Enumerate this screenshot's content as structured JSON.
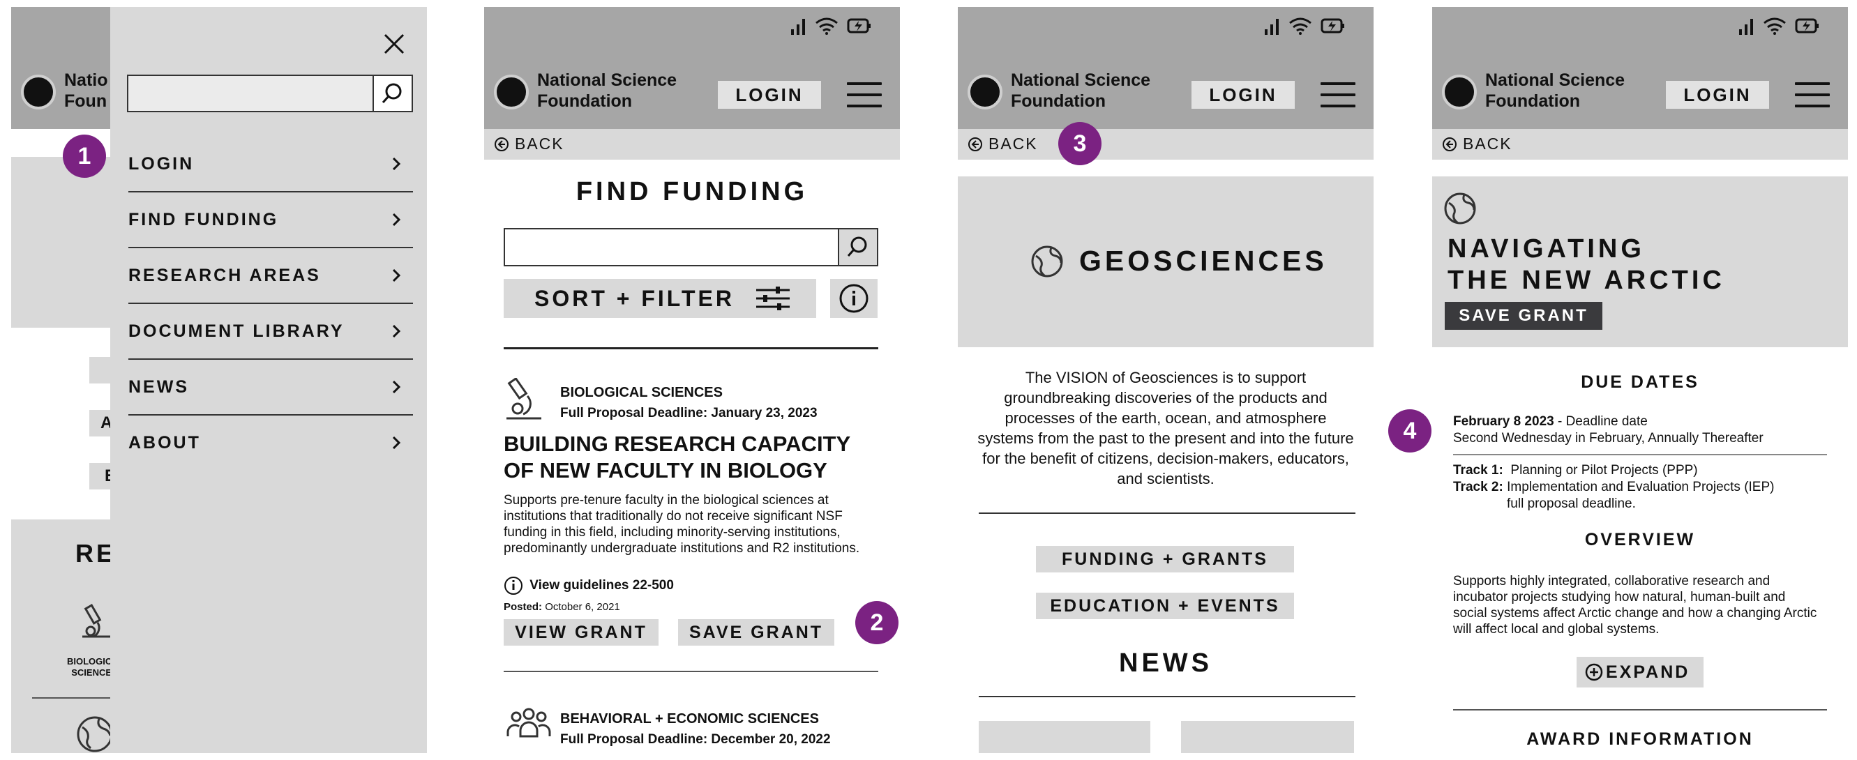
{
  "brand": {
    "line1": "National Science",
    "line2": "Foundation"
  },
  "brand_cutoff": {
    "line1": "Natio",
    "line2": "Foun"
  },
  "login_label": "LOGIN",
  "back_label": "BACK",
  "badges": [
    "1",
    "2",
    "3",
    "4"
  ],
  "menu": {
    "items": [
      {
        "label": "LOGIN"
      },
      {
        "label": "FIND FUNDING"
      },
      {
        "label": "RESEARCH AREAS"
      },
      {
        "label": "DOCUMENT LIBRARY"
      },
      {
        "label": "NEWS"
      },
      {
        "label": "ABOUT"
      }
    ],
    "search_placeholder": ""
  },
  "bg_screen": {
    "letter_a": "A",
    "letter_e": "E",
    "section_title": "RE",
    "bio_label_line1": "BIOLOGIC",
    "bio_label_line2": "SCIENCE"
  },
  "find_funding": {
    "title": "FIND FUNDING",
    "search_placeholder": "",
    "sort_filter_label": "SORT + FILTER",
    "grants": [
      {
        "category": "BIOLOGICAL SCIENCES",
        "deadline": "Full Proposal Deadline: January 23, 2023",
        "title": "BUILDING RESEARCH CAPACITY OF NEW FACULTY IN BIOLOGY",
        "description": "Supports pre-tenure faculty in the biological sciences at institutions that traditionally do not receive significant NSF funding in this field, including minority-serving institutions, predominantly undergraduate institutions and R2 institutions.",
        "guidelines": "View guidelines 22-500",
        "posted_label": "Posted:",
        "posted_date": "October 6, 2021",
        "view_label": "VIEW GRANT",
        "save_label": "SAVE GRANT"
      },
      {
        "category": "BEHAVIORAL + ECONOMIC SCIENCES",
        "deadline": "Full Proposal Deadline: December 20, 2022"
      }
    ]
  },
  "geosciences": {
    "title": "GEOSCIENCES",
    "vision": "The VISION of Geosciences is to support groundbreaking discoveries of the products and processes of the earth, ocean, and atmosphere systems from the past to the present and into the future for the benefit of citizens, decision-makers, educators, and scientists.",
    "funding_label": "FUNDING + GRANTS",
    "education_label": "EDUCATION + EVENTS",
    "news_title": "NEWS"
  },
  "arctic": {
    "title_line1": "NAVIGATING",
    "title_line2": "THE NEW ARCTIC",
    "save_label": "SAVE GRANT",
    "due_dates_title": "DUE DATES",
    "due_date_bold": "February 8 2023",
    "due_date_rest": " - Deadline date",
    "due_date_sub": "Second Wednesday in February, Annually Thereafter",
    "track1_label": "Track 1:",
    "track1_text": "Planning or Pilot Projects (PPP)",
    "track2_label": "Track 2:",
    "track2_text": "Implementation and Evaluation Projects (IEP)",
    "track2_sub": "full proposal deadline.",
    "overview_title": "OVERVIEW",
    "overview_text": "Supports highly integrated, collaborative research and incubator projects studying how natural, human-built and social systems affect Arctic change and how a changing Arctic will affect local and global systems.",
    "expand_label": "EXPAND",
    "award_title": "AWARD INFORMATION"
  },
  "icons": [
    "signal-icon",
    "wifi-icon",
    "battery-charging-icon",
    "close-icon",
    "search-icon",
    "chevron-right-icon",
    "back-arrow-icon",
    "microscope-icon",
    "people-icon",
    "info-icon",
    "sliders-icon",
    "globe-icon",
    "plus-circle-icon",
    "hamburger-icon"
  ]
}
